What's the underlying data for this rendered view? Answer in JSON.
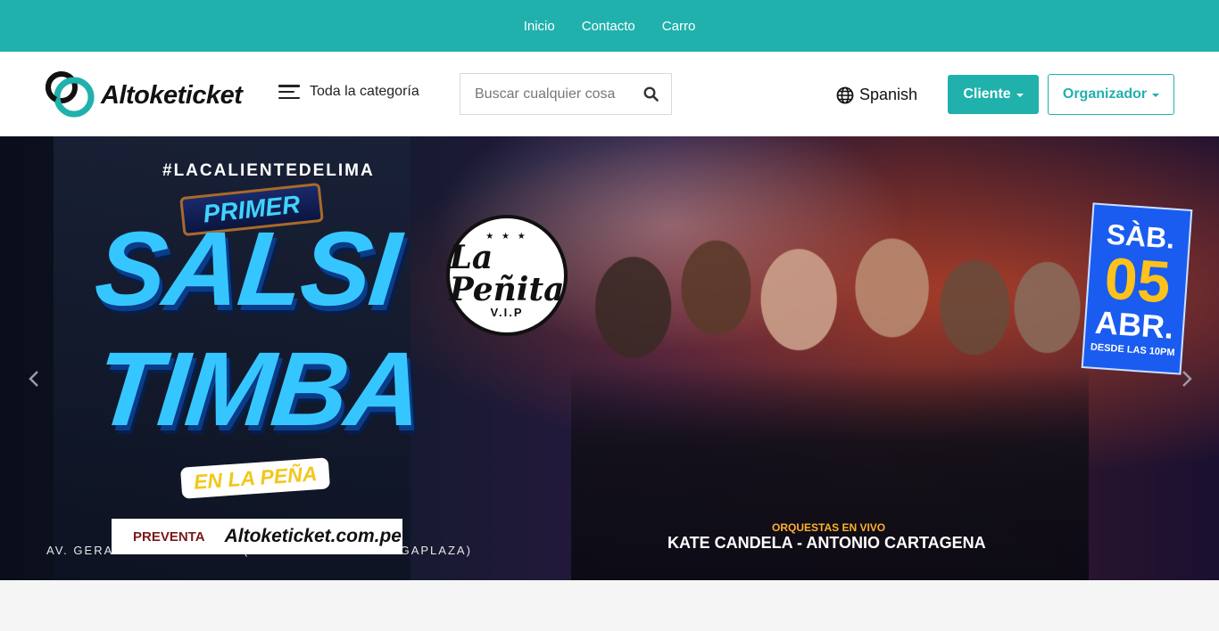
{
  "topnav": {
    "items": [
      {
        "label": "Inicio"
      },
      {
        "label": "Contacto"
      },
      {
        "label": "Carro"
      }
    ]
  },
  "header": {
    "logo_text": "Altoketicket",
    "category_label": "Toda la categoría",
    "search_placeholder": "Buscar cualquier cosa",
    "language_label": "Spanish",
    "cliente_label": "Cliente",
    "organizador_label": "Organizador"
  },
  "hero": {
    "hashtag": "#LACALIENTEDELIMA",
    "primer": "PRIMER",
    "title_line1": "SALSI",
    "title_line2": "TIMBA",
    "subtitle": "EN LA PEÑA",
    "preventa_label": "PREVENTA",
    "preventa_site": "Altoketicket.com.pe",
    "address": "AV. GERARDO UNGER 3415 (A LA ESPALDA DE MEGAPLAZA)",
    "badge_stars": "★ ★ ★",
    "badge_name": "La Peñita",
    "badge_vip": "V.I.P",
    "orquestas_label": "ORQUESTAS EN VIVO",
    "artists": "KATE CANDELA - ANTONIO CARTAGENA",
    "date_day": "SÀB.",
    "date_num": "05",
    "date_month": "ABR.",
    "date_time": "DESDE LAS 10PM"
  },
  "colors": {
    "brand": "#20b1ad",
    "text_dark": "#111111",
    "page_bg": "#f5f5f5"
  },
  "icons": {
    "menu": "menu-icon",
    "search": "search-icon",
    "globe": "globe-icon",
    "prev": "chevron-left-icon",
    "next": "chevron-right-icon"
  }
}
